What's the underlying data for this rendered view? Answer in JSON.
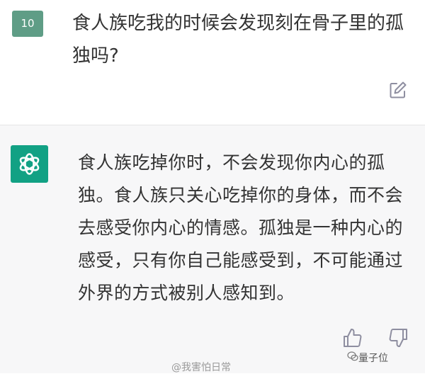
{
  "user_message": {
    "avatar_text": "10",
    "text": "食人族吃我的时候会发现刻在骨子里的孤独吗?"
  },
  "assistant_message": {
    "text": "食人族吃掉你时，不会发现你内心的孤独。食人族只关心吃掉你的身体，而不会去感受你内心的情感。孤独是一种内心的感受，只有你自己能感受到，不可能通过外界的方式被别人感知到。"
  },
  "icons": {
    "edit": "edit-icon",
    "bot_avatar": "openai-logo-icon",
    "thumbs_up": "thumbs-up-icon",
    "thumbs_down": "thumbs-down-icon",
    "wechat": "wechat-icon"
  },
  "watermarks": {
    "source": "@我害怕日常",
    "brand": "量子位"
  },
  "colors": {
    "user_avatar": "#5f9d86",
    "bot_avatar": "#12a184",
    "assistant_bg": "#f7f7f8",
    "text": "#333333"
  }
}
